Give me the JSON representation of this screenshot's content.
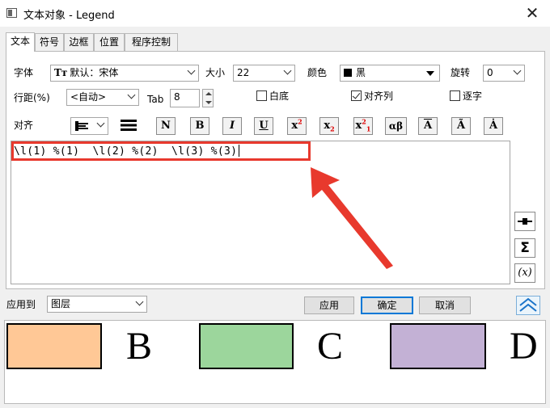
{
  "window": {
    "title": "文本对象 - Legend",
    "close_glyph": "✕"
  },
  "tabs": [
    "文本",
    "符号",
    "边框",
    "位置",
    "程序控制"
  ],
  "font": {
    "label": "字体",
    "value": "默认：宋体",
    "icon": "truetype-icon"
  },
  "size": {
    "label": "大小",
    "value": "22"
  },
  "color": {
    "label": "颜色",
    "value": "黑",
    "swatch": "#000000"
  },
  "rotate": {
    "label": "旋转",
    "value": "0"
  },
  "line_spacing": {
    "label": "行距(%)",
    "value": "<自动>"
  },
  "tab_stop": {
    "label": "Tab",
    "value": "8"
  },
  "checkboxes": {
    "white_bg": {
      "label": "白底",
      "checked": false
    },
    "align_cols": {
      "label": "对齐列",
      "checked": true
    },
    "per_char": {
      "label": "逐字",
      "checked": false
    }
  },
  "align": {
    "label": "对齐"
  },
  "format_buttons": {
    "normal": "N",
    "bold": "B",
    "italic": "I",
    "underline": "U",
    "superscript": "x",
    "subscript": "x",
    "supsub": "x",
    "greek": "αβ",
    "bar": "A",
    "tilde": "Ã",
    "dot": "Ȧ"
  },
  "editor": {
    "text": "\\l(1) %(1)  \\l(2) %(2)  \\l(3) %(3)"
  },
  "side_buttons": {
    "sigma": "Σ",
    "func": "(x)"
  },
  "apply_to": {
    "label": "应用到",
    "value": "图层"
  },
  "buttons": {
    "apply": "应用",
    "ok": "确定",
    "cancel": "取消"
  },
  "legend": [
    {
      "letter": "B",
      "color": "#ffc896"
    },
    {
      "letter": "C",
      "color": "#9cd69c"
    },
    {
      "letter": "D",
      "color": "#c3b1d5"
    }
  ],
  "colors": {
    "accent": "#e8392d"
  }
}
